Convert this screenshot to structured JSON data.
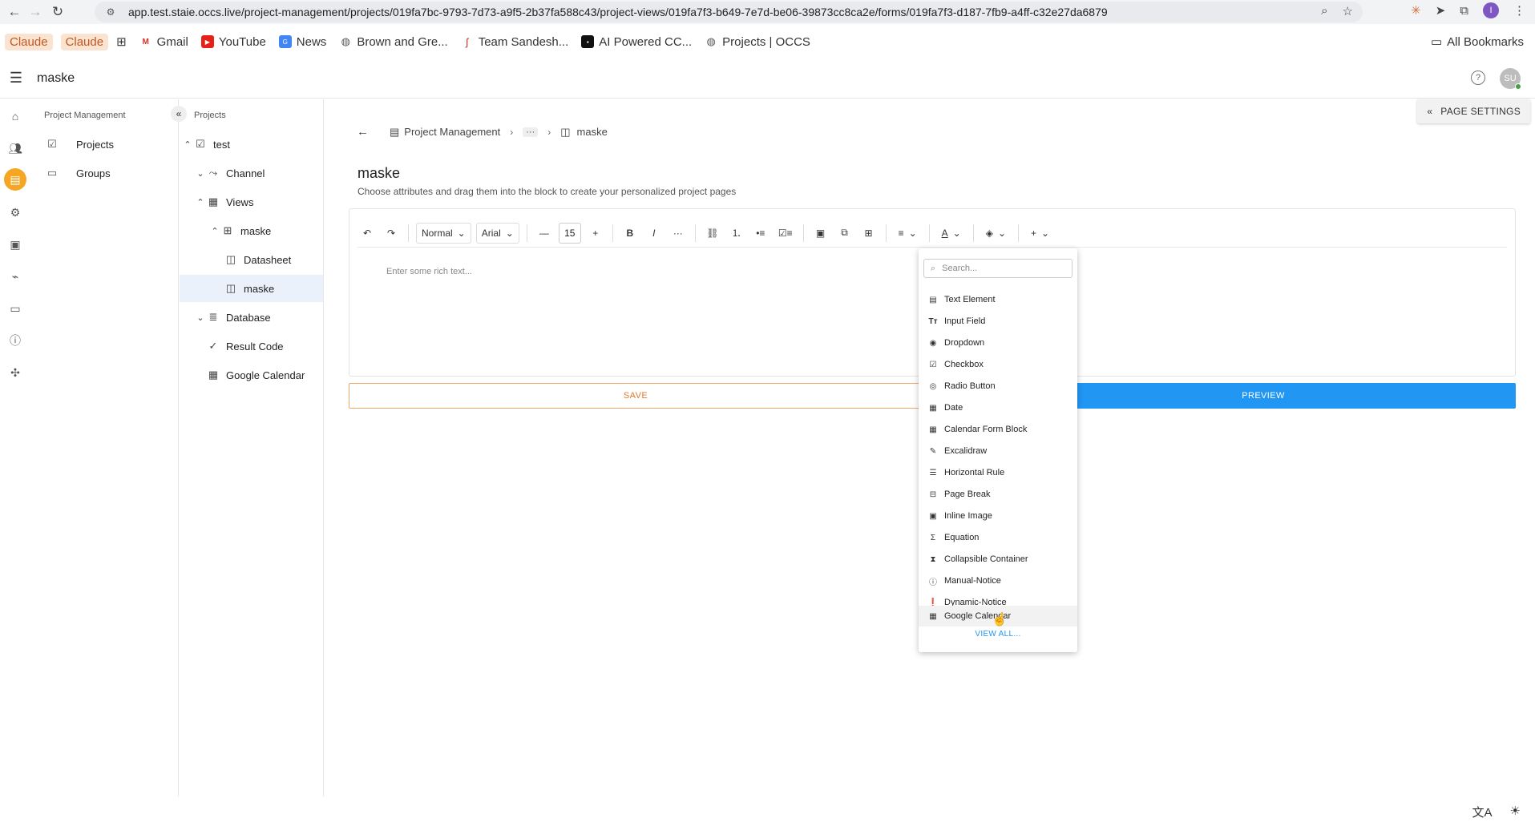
{
  "browser": {
    "url": "app.test.staie.occs.live/project-management/projects/019fa7bc-9793-7d73-a9f5-2b37fa588c43/project-views/019fa7f3-b649-7e7d-be06-39873cc8ca2e/forms/019fa7f3-d187-7fb9-a4ff-c32e27da6879",
    "profile_initial": "I",
    "bookmarks": [
      {
        "label": "Claude",
        "icon": "claude-icon"
      },
      {
        "label": "Claude",
        "icon": "claude-icon"
      },
      {
        "label": "Gmail",
        "icon": "gmail-icon"
      },
      {
        "label": "YouTube",
        "icon": "youtube-icon"
      },
      {
        "label": "News",
        "icon": "news-icon"
      },
      {
        "label": "Brown and Gre...",
        "icon": "globe-icon"
      },
      {
        "label": "Team Sandesh...",
        "icon": "team-icon"
      },
      {
        "label": "AI Powered CC...",
        "icon": "ai-icon"
      },
      {
        "label": "Projects | OCCS",
        "icon": "globe-icon"
      }
    ],
    "all_bookmarks": "All Bookmarks"
  },
  "header": {
    "title": "maske",
    "avatar_initials": "SU"
  },
  "section_panel": {
    "title": "Project Management",
    "items": [
      {
        "label": "Projects",
        "icon": "checkbox-icon"
      },
      {
        "label": "Groups",
        "icon": "folder-icon"
      }
    ]
  },
  "tree": {
    "title": "Projects",
    "items": [
      {
        "label": "test",
        "icon": "checkbox-icon",
        "chevron": "up"
      },
      {
        "label": "Channel",
        "icon": "channel-icon",
        "chevron": "down"
      },
      {
        "label": "Views",
        "icon": "grid-icon",
        "chevron": "up"
      },
      {
        "label": "maske",
        "icon": "table-icon",
        "chevron": "up"
      },
      {
        "label": "Datasheet",
        "icon": "layout-icon",
        "chevron": ""
      },
      {
        "label": "maske",
        "icon": "layout-icon",
        "chevron": ""
      },
      {
        "label": "Database",
        "icon": "list-icon",
        "chevron": "down"
      },
      {
        "label": "Result Code",
        "icon": "check-icon",
        "chevron": ""
      },
      {
        "label": "Google Calendar",
        "icon": "calendar-icon",
        "chevron": ""
      }
    ]
  },
  "main": {
    "page_settings": "PAGE SETTINGS",
    "breadcrumb": {
      "root": "Project Management",
      "ellipsis": "···",
      "current": "maske"
    },
    "heading": "maske",
    "subtitle": "Choose attributes and drag them into the block to create your personalized project pages",
    "editor": {
      "block_type": "Normal",
      "font": "Arial",
      "font_size": "15",
      "placeholder": "Enter some rich text..."
    },
    "save_label": "SAVE",
    "preview_label": "PREVIEW"
  },
  "menu": {
    "search_placeholder": "Search...",
    "items": [
      {
        "label": "Text Element",
        "icon": "text-element-icon"
      },
      {
        "label": "Input Field",
        "icon": "input-field-icon"
      },
      {
        "label": "Dropdown",
        "icon": "dropdown-icon"
      },
      {
        "label": "Checkbox",
        "icon": "checkbox-icon"
      },
      {
        "label": "Radio Button",
        "icon": "radio-icon"
      },
      {
        "label": "Date",
        "icon": "date-icon"
      },
      {
        "label": "Calendar Form Block",
        "icon": "calendar-icon"
      },
      {
        "label": "Excalidraw",
        "icon": "pen-icon"
      },
      {
        "label": "Horizontal Rule",
        "icon": "rule-icon"
      },
      {
        "label": "Page Break",
        "icon": "page-break-icon"
      },
      {
        "label": "Inline Image",
        "icon": "image-icon"
      },
      {
        "label": "Equation",
        "icon": "sigma-icon"
      },
      {
        "label": "Collapsible Container",
        "icon": "collapse-icon"
      },
      {
        "label": "Manual-Notice",
        "icon": "notice-icon"
      },
      {
        "label": "Dynamic-Notice",
        "icon": "notice-filled-icon"
      },
      {
        "label": "Google Calendar",
        "icon": "calendar-icon"
      }
    ],
    "view_all": "VIEW ALL..."
  },
  "colors": {
    "accent_orange": "#f5a623",
    "save_orange": "#e07a2e",
    "preview_blue": "#2196f3",
    "selection": "#eaf1fb"
  }
}
